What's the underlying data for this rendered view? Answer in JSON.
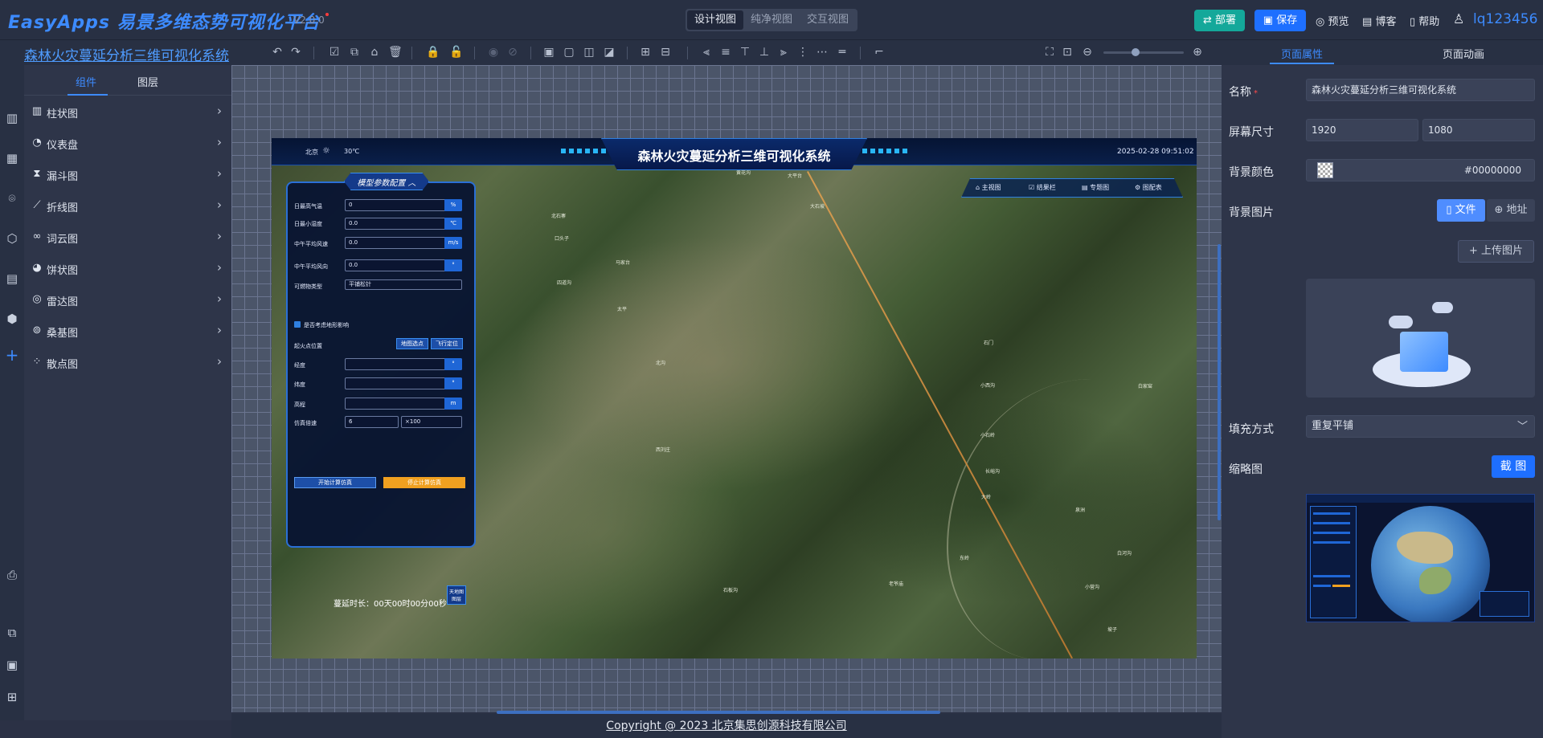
{
  "app": {
    "logo": "EasyApps 易景多维态势可视化平台",
    "version": "V2.0.0",
    "user": "lq123456"
  },
  "view_tabs": [
    "设计视图",
    "纯净视图",
    "交互视图"
  ],
  "top_actions": {
    "deploy": "部署",
    "save": "保存",
    "preview": "预览",
    "blog": "博客",
    "help": "帮助"
  },
  "page_link": "森林火灾蔓延分析三维可视化系统",
  "left_tabs": [
    "组件",
    "图层"
  ],
  "categories": [
    "柱状图",
    "仪表盘",
    "漏斗图",
    "折线图",
    "词云图",
    "饼状图",
    "雷达图",
    "桑基图",
    "散点图"
  ],
  "right_tabs": [
    "页面属性",
    "页面动画"
  ],
  "props": {
    "name_label": "名称",
    "name_value": "森林火灾蔓延分析三维可视化系统",
    "size_label": "屏幕尺寸",
    "width": "1920",
    "height": "1080",
    "bg_color_label": "背景颜色",
    "bg_color_value": "#00000000",
    "bg_image_label": "背景图片",
    "file_btn": "文件",
    "url_btn": "地址",
    "upload_btn": "上传图片",
    "fill_label": "填充方式",
    "fill_value": "重复平铺",
    "thumb_label": "缩略图",
    "crop_btn": "截 图"
  },
  "footer": "Copyright @ 2023 北京集思创源科技有限公司",
  "screen": {
    "title": "森林火灾蔓延分析三维可视化系统",
    "city": "北京",
    "temp": "30℃",
    "datetime": "2025-02-28 09:51:02",
    "nav": [
      "主视图",
      "结果栏",
      "专题图",
      "图配表"
    ],
    "panel_title": "模型参数配置",
    "fields": [
      {
        "label": "日最高气温",
        "value": "0",
        "unit": "%"
      },
      {
        "label": "日最小湿度",
        "value": "0.0",
        "unit": "℃"
      },
      {
        "label": "中午平均风速",
        "value": "0.0",
        "unit": "m/s"
      },
      {
        "label": "中午平均风向",
        "value": "0.0",
        "unit": "°"
      }
    ],
    "fuel_label": "可燃物类型",
    "fuel_value": "平铺松针",
    "terrain_check": "是否考虑地形影响",
    "ignition_label": "起火点位置",
    "map_pick": "地图选点",
    "fly_locate": "飞行定位",
    "coords": [
      {
        "label": "经度",
        "unit": "°"
      },
      {
        "label": "纬度",
        "unit": "°"
      },
      {
        "label": "高程",
        "unit": "m"
      }
    ],
    "speed_label": "仿真倍速",
    "speed_value": "6",
    "speed_mult": "×100",
    "start_btn": "开始计算仿真",
    "stop_btn": "停止计算仿真",
    "duration": "蔓延时长：00天00时00分00秒",
    "tianditu_btn": "天地图图层",
    "places": [
      "黄花沟",
      "大平台",
      "口头子",
      "北石寨",
      "马家台",
      "太平",
      "四道沟",
      "北沟",
      "大石坡",
      "西刘庄",
      "石门",
      "小西沟",
      "白家窑",
      "小石岭",
      "长峪沟",
      "大岭",
      "泉洲",
      "老爷庙",
      "东岭",
      "小营沟",
      "白河沟",
      "石板沟",
      "坡子"
    ]
  }
}
